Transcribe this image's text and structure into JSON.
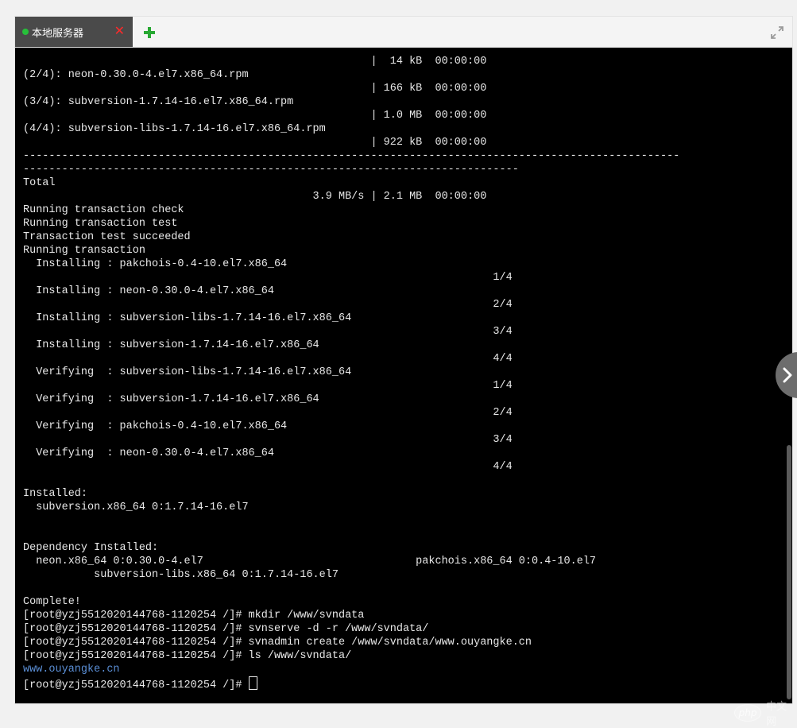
{
  "tabs": {
    "active_tab": {
      "label": "本地服务器",
      "status_color": "#27c03a",
      "close_icon": "close-icon"
    },
    "add_tab_icon": "plus-icon",
    "fullscreen_icon": "fullscreen-icon"
  },
  "terminal": {
    "lines": [
      {
        "text": "                                                      |  14 kB  00:00:00"
      },
      {
        "text": "(2/4): neon-0.30.0-4.el7.x86_64.rpm"
      },
      {
        "text": "                                                      | 166 kB  00:00:00"
      },
      {
        "text": "(3/4): subversion-1.7.14-16.el7.x86_64.rpm"
      },
      {
        "text": "                                                      | 1.0 MB  00:00:00"
      },
      {
        "text": "(4/4): subversion-libs-1.7.14-16.el7.x86_64.rpm"
      },
      {
        "text": "                                                      | 922 kB  00:00:00"
      },
      {
        "text": "------------------------------------------------------------------------------------------------------"
      },
      {
        "text": "-----------------------------------------------------------------------------"
      },
      {
        "text": "Total"
      },
      {
        "text": "                                             3.9 MB/s | 2.1 MB  00:00:00"
      },
      {
        "text": "Running transaction check"
      },
      {
        "text": "Running transaction test"
      },
      {
        "text": "Transaction test succeeded"
      },
      {
        "text": "Running transaction"
      },
      {
        "text": "  Installing : pakchois-0.4-10.el7.x86_64"
      },
      {
        "text": "                                                                         1/4"
      },
      {
        "text": "  Installing : neon-0.30.0-4.el7.x86_64"
      },
      {
        "text": "                                                                         2/4"
      },
      {
        "text": "  Installing : subversion-libs-1.7.14-16.el7.x86_64"
      },
      {
        "text": "                                                                         3/4"
      },
      {
        "text": "  Installing : subversion-1.7.14-16.el7.x86_64"
      },
      {
        "text": "                                                                         4/4"
      },
      {
        "text": "  Verifying  : subversion-libs-1.7.14-16.el7.x86_64"
      },
      {
        "text": "                                                                         1/4"
      },
      {
        "text": "  Verifying  : subversion-1.7.14-16.el7.x86_64"
      },
      {
        "text": "                                                                         2/4"
      },
      {
        "text": "  Verifying  : pakchois-0.4-10.el7.x86_64"
      },
      {
        "text": "                                                                         3/4"
      },
      {
        "text": "  Verifying  : neon-0.30.0-4.el7.x86_64"
      },
      {
        "text": "                                                                         4/4"
      },
      {
        "text": ""
      },
      {
        "text": "Installed:"
      },
      {
        "text": "  subversion.x86_64 0:1.7.14-16.el7"
      },
      {
        "text": ""
      },
      {
        "text": ""
      },
      {
        "text": "Dependency Installed:"
      },
      {
        "text": "  neon.x86_64 0:0.30.0-4.el7                                 pakchois.x86_64 0:0.4-10.el7"
      },
      {
        "text": "           subversion-libs.x86_64 0:1.7.14-16.el7"
      },
      {
        "text": ""
      },
      {
        "text": "Complete!"
      },
      {
        "text": "[root@yzj5512020144768-1120254 /]# mkdir /www/svndata"
      },
      {
        "text": "[root@yzj5512020144768-1120254 /]# svnserve -d -r /www/svndata/"
      },
      {
        "text": "[root@yzj5512020144768-1120254 /]# svnadmin create /www/svndata/www.ouyangke.cn"
      },
      {
        "text": "[root@yzj5512020144768-1120254 /]# ls /www/svndata/"
      },
      {
        "text": "www.ouyangke.cn",
        "color": "#5b8fd6"
      },
      {
        "text": "[root@yzj5512020144768-1120254 /]# ",
        "cursor": true
      }
    ],
    "colors": {
      "background": "#000000",
      "foreground": "#e8e8e8",
      "directory": "#5b8fd6"
    }
  },
  "side_panel_toggle_icon": "chevron-right-icon",
  "watermark": {
    "logo_text": "php",
    "site_text": "中文网"
  }
}
